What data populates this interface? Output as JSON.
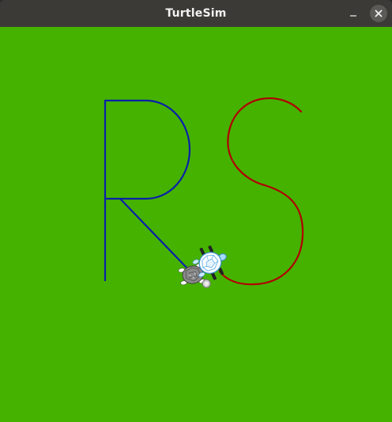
{
  "window": {
    "title": "TurtleSim"
  },
  "canvas": {
    "background_color": "#45b200"
  },
  "drawings": {
    "letter_r": {
      "color": "#0a20a8"
    },
    "letter_s": {
      "color": "#b00000"
    }
  },
  "turtles": [
    {
      "name": "turtle-gray",
      "icon": "turtle-icon"
    },
    {
      "name": "turtle-white-blue",
      "icon": "turtle-icon"
    }
  ],
  "icons": {
    "minimize": "minimize-icon",
    "close": "close-icon"
  }
}
